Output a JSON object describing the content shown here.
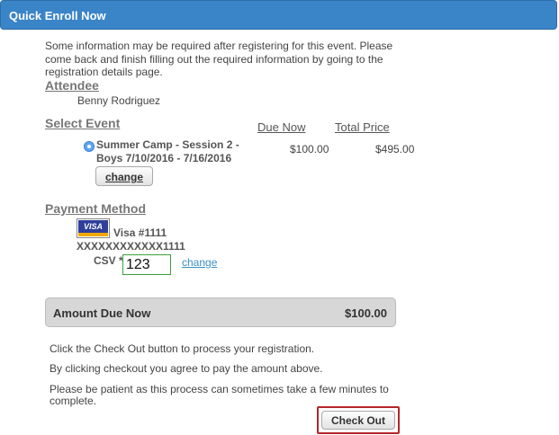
{
  "header": {
    "title": "Quick Enroll Now"
  },
  "intro_text": "Some information may be required after registering for this event. Please come back and finish filling out the required information by going to the registration details page.",
  "attendee": {
    "heading": "Attendee",
    "name": "Benny Rodriguez"
  },
  "event": {
    "heading": "Select Event",
    "due_now_header": "Due Now",
    "total_price_header": "Total Price",
    "name_line1": "Summer Camp - Session 2 -",
    "name_line2": "Boys 7/10/2016 - 7/16/2016",
    "due_now": "$100.00",
    "total_price": "$495.00",
    "change_label": "change"
  },
  "payment": {
    "heading": "Payment Method",
    "card_logo": "VISA",
    "card_label": "Visa #1111",
    "card_number": "XXXXXXXXXXXX1111",
    "csv_label": "CSV *",
    "csv_value": "123",
    "change_link": "change"
  },
  "amount_due": {
    "label": "Amount Due Now",
    "value": "$100.00"
  },
  "notes": [
    "Click the Check Out button to process your registration.",
    "By clicking checkout you agree to pay the amount above.",
    "Please be patient as this process can sometimes take a few minutes to complete."
  ],
  "checkout_label": "Check Out",
  "colors": {
    "header_blue": "#3a84c8",
    "link_blue": "#3b8fc4",
    "checkout_border": "#b3262a",
    "csv_border": "#3aa13a"
  }
}
